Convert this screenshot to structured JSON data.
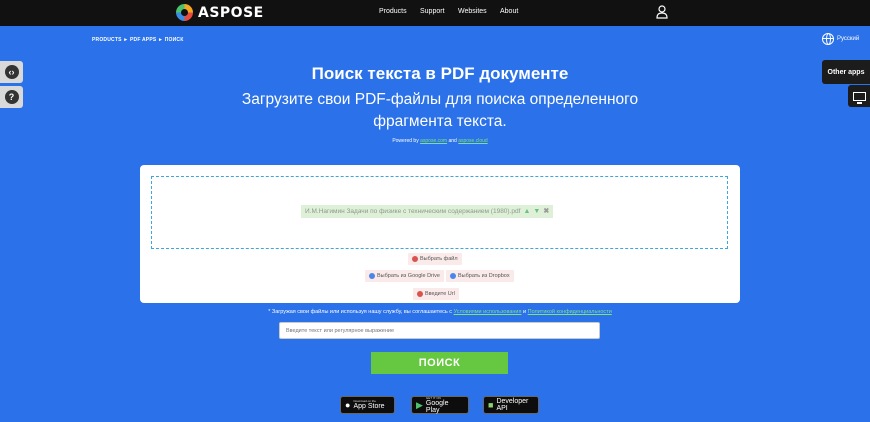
{
  "brand": {
    "name": "ASPOSE"
  },
  "nav": {
    "items": [
      "Products",
      "Support",
      "Websites",
      "About"
    ]
  },
  "breadcrumb": {
    "text": "PRODUCTS  ►  PDF APPS  ►  ПОИСК"
  },
  "language": {
    "label": "Русский"
  },
  "side": {
    "other_apps": "Other apps"
  },
  "header": {
    "title": "Поиск текста в PDF документе",
    "subtitle": "Загрузите свои PDF-файлы для поиска определенного фрагмента текста.",
    "powered_prefix": "Powered by",
    "powered_link1": "aspose.com",
    "powered_and": "and",
    "powered_link2": "aspose.cloud"
  },
  "upload": {
    "file_name": "И.М.Нагимин Задачи по физике с техническим содержанием (1980).pdf",
    "choose_file": "Выбрать файл",
    "google_drive": "Выбрать из Google Drive",
    "dropbox": "Выбрать из Dropbox",
    "url": "Введите Url"
  },
  "terms": {
    "prefix": "* Загружая свои файлы или используя нашу службу, вы соглашаетесь с",
    "tos": "Условиями использования",
    "and": "и",
    "privacy": "Политикой конфиденциальности"
  },
  "search": {
    "placeholder": "Введите текст или регулярное выражение",
    "button": "ПОИСК"
  },
  "badges": {
    "appstore_small": "Download on the",
    "appstore_big": "App Store",
    "google_small": "GET IT ON",
    "google_big": "Google Play",
    "api_big": "Developer API"
  }
}
